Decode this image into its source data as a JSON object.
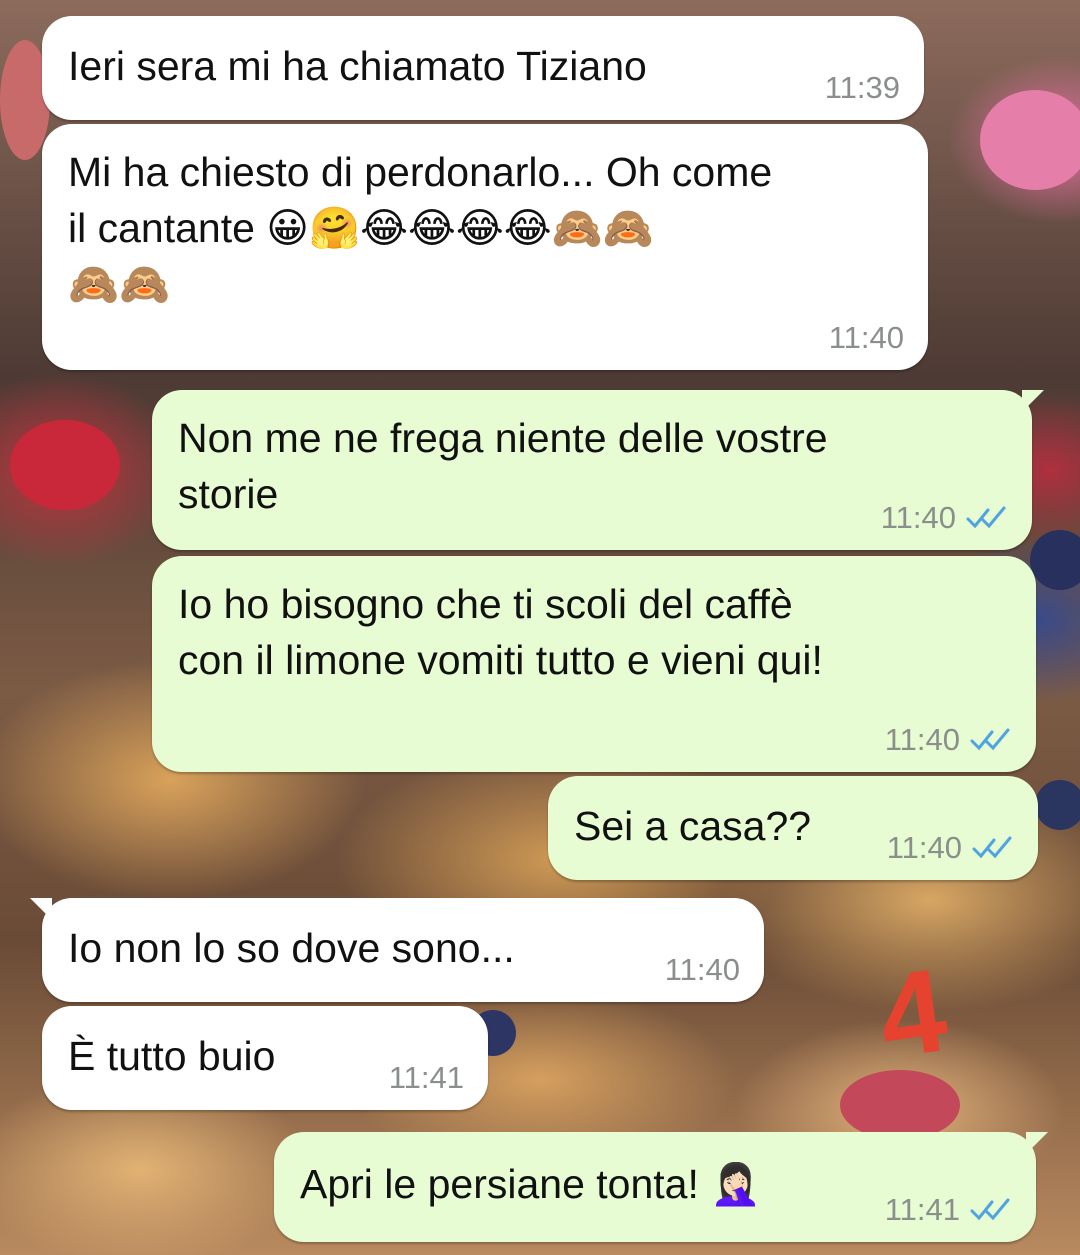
{
  "messages": [
    {
      "text": "Ieri sera mi ha chiamato Tiziano",
      "time": "11:39",
      "direction": "incoming"
    },
    {
      "text": "Mi ha chiesto di perdonarlo... Oh come\nil cantante 😀🤗😂😂😂😂🙈🙈\n🙈🙈",
      "time": "11:40",
      "direction": "incoming"
    },
    {
      "text": "Non me ne frega niente delle vostre\nstorie",
      "time": "11:40",
      "direction": "outgoing",
      "status": "read"
    },
    {
      "text": "Io ho bisogno che ti scoli del caffè\ncon il limone vomiti tutto e vieni qui!",
      "time": "11:40",
      "direction": "outgoing",
      "status": "read"
    },
    {
      "text": "Sei a casa??",
      "time": "11:40",
      "direction": "outgoing",
      "status": "read"
    },
    {
      "text": "Io non lo so dove sono...",
      "time": "11:40",
      "direction": "incoming"
    },
    {
      "text": "È tutto buio",
      "time": "11:41",
      "direction": "incoming"
    },
    {
      "text": "Apri le persiane tonta! 🤦🏻‍♀️",
      "time": "11:41",
      "direction": "outgoing",
      "status": "read"
    }
  ],
  "overlay": {
    "doodle": "4"
  },
  "colors": {
    "incoming_bubble": "#ffffff",
    "outgoing_bubble": "#e7fcd3",
    "timestamp": "#8a8f8c",
    "read_ticks": "#4fa3e0",
    "doodle": "#e5432f"
  },
  "icons": {
    "read_receipt": "double-check-icon"
  }
}
